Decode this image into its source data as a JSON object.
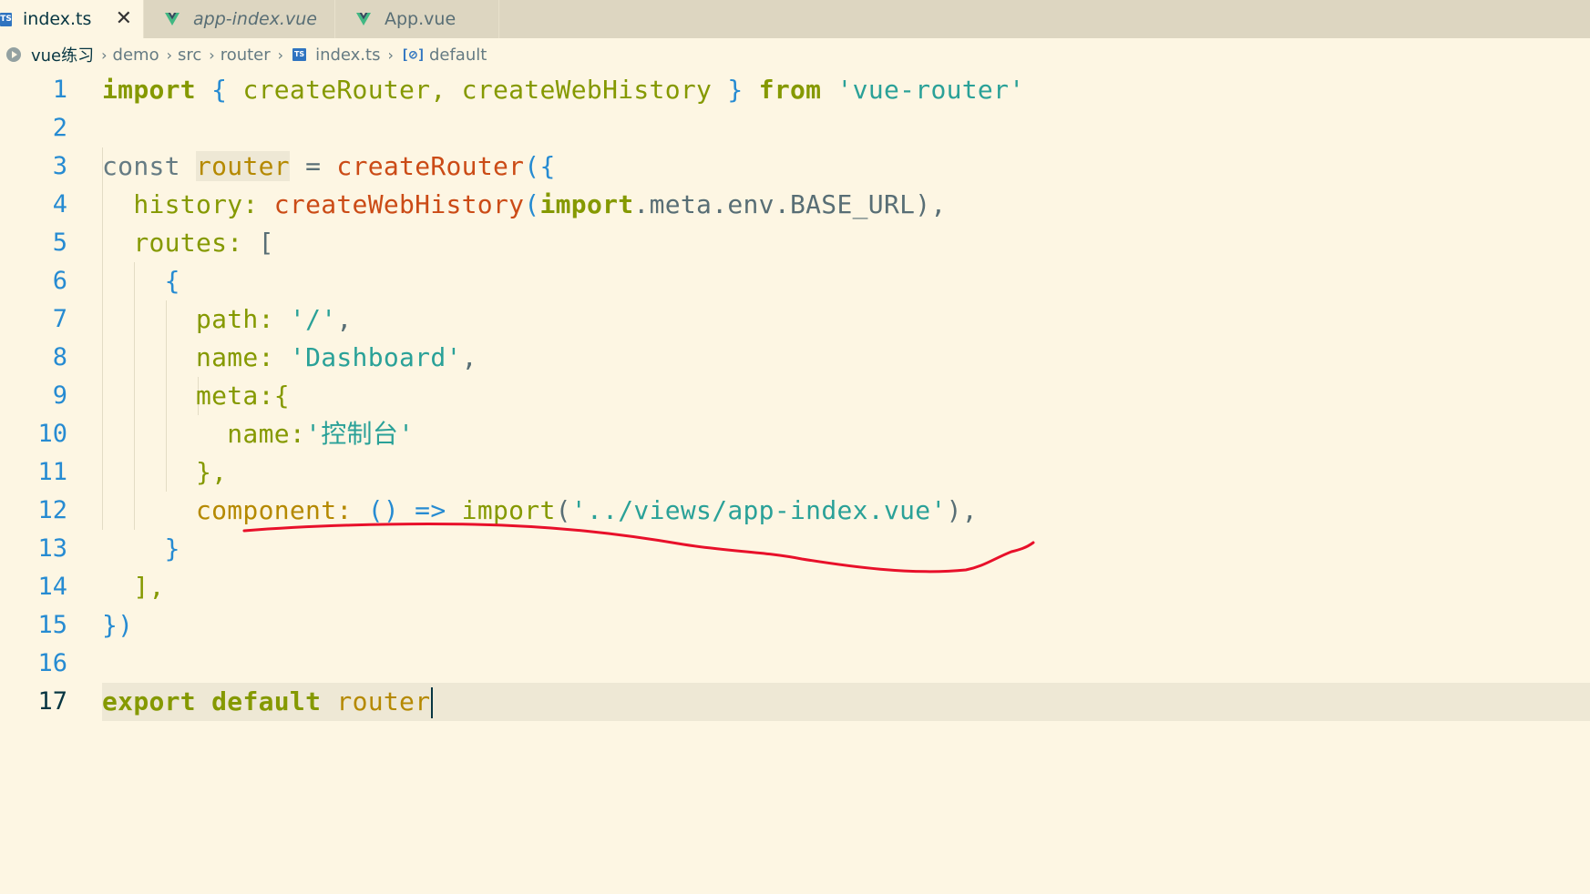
{
  "tabs": [
    {
      "label": "index.ts",
      "icon": "ts-file-icon",
      "active": true
    },
    {
      "label": "app-index.vue",
      "icon": "vue-file-icon",
      "active": false
    },
    {
      "label": "App.vue",
      "icon": "vue-file-icon",
      "active": false
    }
  ],
  "breadcrumb": {
    "items": [
      "vue练习",
      "demo",
      "src",
      "router",
      "index.ts",
      "default"
    ]
  },
  "editor": {
    "current_line": 17,
    "line_numbers": [
      "1",
      "2",
      "3",
      "4",
      "5",
      "6",
      "7",
      "8",
      "9",
      "10",
      "11",
      "12",
      "13",
      "14",
      "15",
      "16",
      "17"
    ],
    "lines": {
      "l1": {
        "import": "import",
        "ob": "{",
        "a": " createRouter, createWebHistory ",
        "cb": "}",
        "from": "from",
        "str": "'vue-router'"
      },
      "l3": {
        "const": "const",
        "router": "router",
        "eq": " = ",
        "fn": "createRouter",
        "p": "({"
      },
      "l4": {
        "history": "history:",
        "fn": "createWebHistory",
        "p1": "(",
        "imp": "import",
        "rest": ".meta.env.BASE_URL),"
      },
      "l5": {
        "routes": "routes:",
        "br": "["
      },
      "l6": {
        "ob": "{"
      },
      "l7": {
        "path": "path:",
        "str": "'/'",
        "comma": ","
      },
      "l8": {
        "name": "name:",
        "str": "'Dashboard'",
        "comma": ","
      },
      "l9": {
        "meta": "meta:{"
      },
      "l10": {
        "name": "name:",
        "str": "'控制台'"
      },
      "l11": {
        "cb": "},"
      },
      "l12": {
        "component": "component:",
        "arrow": "() =>",
        "imp": "import",
        "p1": "(",
        "str": "'../views/app-index.vue'",
        "rest": "),"
      },
      "l13": {
        "cb": "}"
      },
      "l14": {
        "cb": "],"
      },
      "l15": {
        "cb": "})"
      },
      "l17": {
        "export": "export",
        "default": "default",
        "router": "router"
      }
    }
  },
  "colors": {
    "background": "#fdf6e3",
    "keyword": "#859900",
    "string": "#2aa198",
    "function": "#b58900",
    "line_number": "#268bd2",
    "annotation": "#e8102a"
  }
}
